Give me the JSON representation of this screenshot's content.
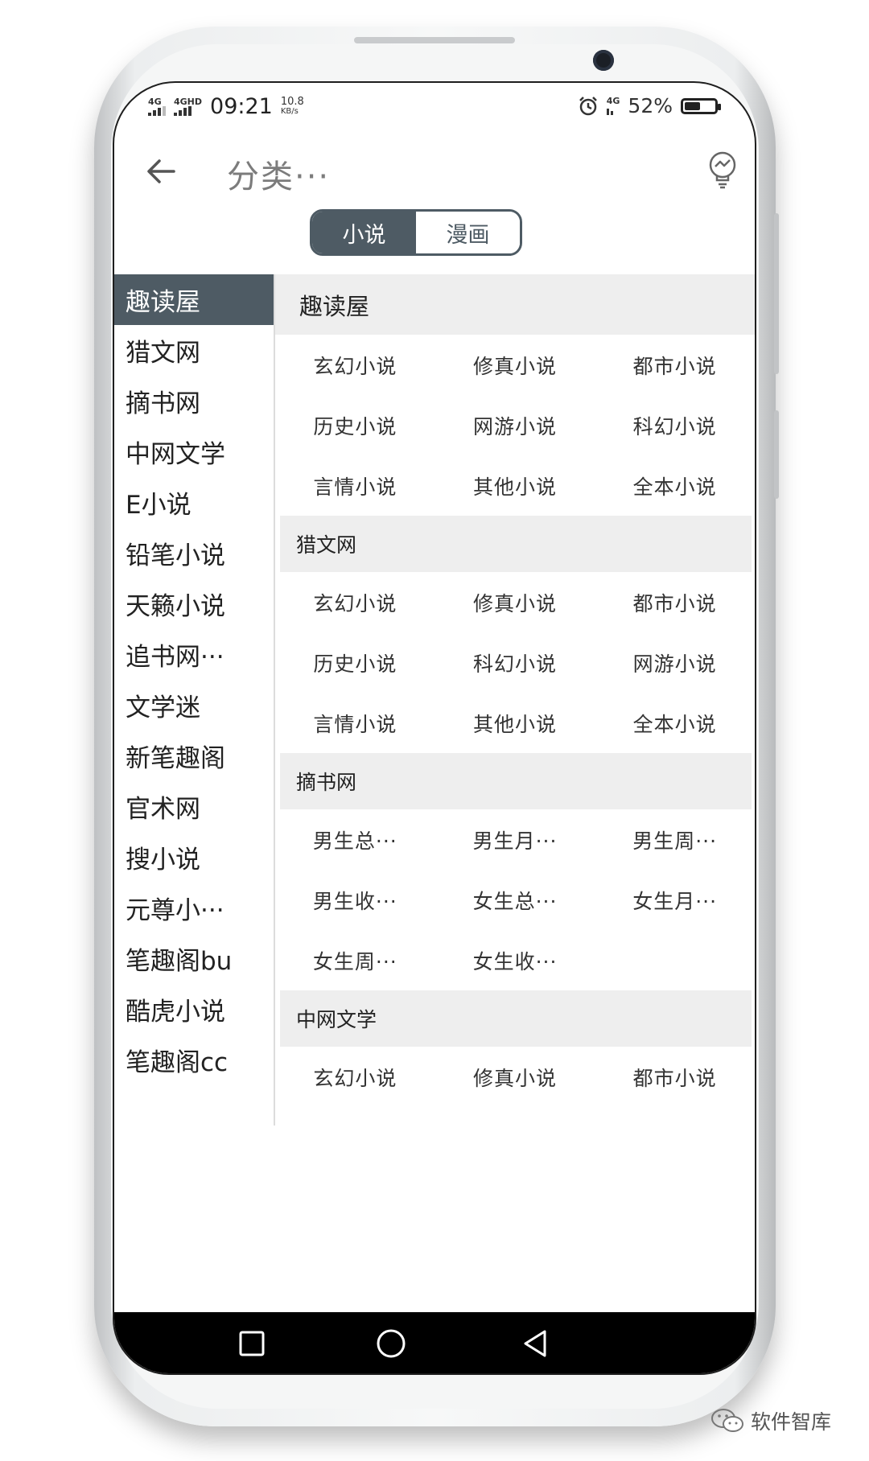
{
  "status_bar": {
    "net1": "4G",
    "net2": "4GHD",
    "time": "09:21",
    "speed_value": "10.8",
    "speed_unit": "KB/s",
    "net3": "4G",
    "battery": "52%",
    "battery_level": 0.52
  },
  "header": {
    "title": "分类···",
    "back_icon": "arrow-left-icon",
    "right_icon": "lightbulb-icon"
  },
  "toggle": {
    "options": [
      "小说",
      "漫画"
    ],
    "selected": "小说"
  },
  "sidebar": {
    "items": [
      "趣读屋",
      "猎文网",
      "摘书网",
      "中网文学",
      "E小说",
      "铅笔小说",
      "天籁小说",
      "追书网···",
      "文学迷",
      "新笔趣阁",
      "官术网",
      "搜小说",
      "元尊小···",
      "笔趣阁bu",
      "酷虎小说",
      "笔趣阁cc"
    ],
    "selected": "趣读屋"
  },
  "sections": [
    {
      "title": "趣读屋",
      "items": [
        "玄幻小说",
        "修真小说",
        "都市小说",
        "历史小说",
        "网游小说",
        "科幻小说",
        "言情小说",
        "其他小说",
        "全本小说"
      ]
    },
    {
      "title": "猎文网",
      "items": [
        "玄幻小说",
        "修真小说",
        "都市小说",
        "历史小说",
        "科幻小说",
        "网游小说",
        "言情小说",
        "其他小说",
        "全本小说"
      ]
    },
    {
      "title": "摘书网",
      "items": [
        "男生总···",
        "男生月···",
        "男生周···",
        "男生收···",
        "女生总···",
        "女生月···",
        "女生周···",
        "女生收···"
      ]
    },
    {
      "title": "中网文学",
      "items": [
        "玄幻小说",
        "修真小说",
        "都市小说"
      ]
    }
  ],
  "watermark": "软件智库",
  "colors": {
    "accent": "#4e5b64",
    "section_bg": "#eeeeee",
    "nav_bg": "#000000"
  }
}
